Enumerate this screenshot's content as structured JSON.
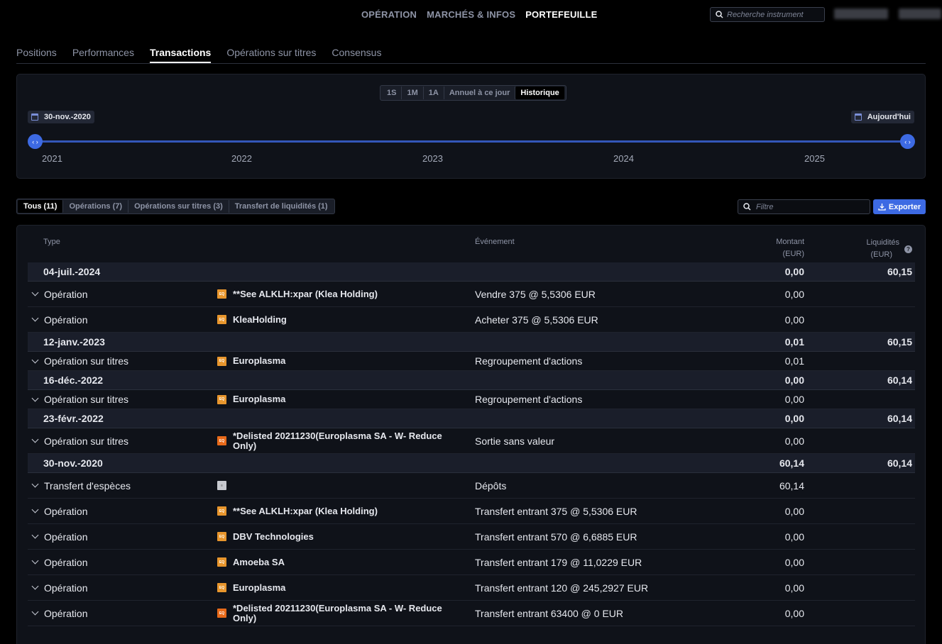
{
  "nav": {
    "links": [
      "OPÉRATION",
      "MARCHÉS & INFOS",
      "PORTEFEUILLE"
    ],
    "active": 2,
    "search_placeholder": "Recherche instrument"
  },
  "tabs": {
    "items": [
      "Positions",
      "Performances",
      "Transactions",
      "Opérations sur titres",
      "Consensus"
    ],
    "active": 2
  },
  "timeline": {
    "periods": [
      "1S",
      "1M",
      "1A",
      "Annuel à ce jour",
      "Historique"
    ],
    "active_period": 4,
    "start_date": "30-nov.-2020",
    "end_date": "Aujourd'hui",
    "years": [
      "2021",
      "2022",
      "2023",
      "2024",
      "2025"
    ],
    "handle_glyph": "‹ ›"
  },
  "filters": {
    "items": [
      "Tous (11)",
      "Opérations (7)",
      "Opérations sur titres (3)",
      "Transfert de liquidités (1)"
    ],
    "active": 0,
    "filter_placeholder": "Filtre",
    "export_label": "Exporter"
  },
  "table": {
    "headers": {
      "type": "Type",
      "event": "Événement",
      "amount": "Montant",
      "amount_unit": "(EUR)",
      "cash": "Liquidités",
      "cash_unit": "(EUR)"
    },
    "rows": [
      {
        "kind": "date",
        "label": "04-juil.-2024",
        "amount": "0,00",
        "cash": "60,15"
      },
      {
        "kind": "tx",
        "type": "Opération",
        "badge": "EQ",
        "instrument": "**See ALKLH:xpar (Klea Holding)",
        "event": "Vendre 375 @ 5,5306 EUR",
        "amount": "0,00"
      },
      {
        "kind": "tx",
        "type": "Opération",
        "badge": "EQ",
        "instrument": "KleaHolding",
        "event": "Acheter 375 @ 5,5306 EUR",
        "amount": "0,00"
      },
      {
        "kind": "date",
        "label": "12-janv.-2023",
        "amount": "0,01",
        "cash": "60,15"
      },
      {
        "kind": "tx",
        "short": true,
        "type": "Opération sur titres",
        "badge": "EQ",
        "instrument": "Europlasma",
        "event": "Regroupement d'actions",
        "amount": "0,01"
      },
      {
        "kind": "date",
        "label": "16-déc.-2022",
        "amount": "0,00",
        "cash": "60,14"
      },
      {
        "kind": "tx",
        "short": true,
        "type": "Opération sur titres",
        "badge": "EQ",
        "instrument": "Europlasma",
        "event": "Regroupement d'actions",
        "amount": "0,00"
      },
      {
        "kind": "date",
        "label": "23-févr.-2022",
        "amount": "0,00",
        "cash": "60,14"
      },
      {
        "kind": "tx",
        "type": "Opération sur titres",
        "badge": "W",
        "instrument": "*Delisted 20211230(Europlasma SA - W- Reduce Only)",
        "event": "Sortie sans valeur",
        "amount": "0,00"
      },
      {
        "kind": "date",
        "label": "30-nov.-2020",
        "amount": "60,14",
        "cash": "60,14"
      },
      {
        "kind": "tx",
        "type": "Transfert d'espèces",
        "badge": "CASH",
        "instrument": "",
        "event": "Dépôts",
        "amount": "60,14"
      },
      {
        "kind": "tx",
        "type": "Opération",
        "badge": "EQ",
        "instrument": "**See ALKLH:xpar (Klea Holding)",
        "event": "Transfert entrant 375 @ 5,5306 EUR",
        "amount": "0,00"
      },
      {
        "kind": "tx",
        "type": "Opération",
        "badge": "EQ",
        "instrument": "DBV Technologies",
        "event": "Transfert entrant 570 @ 6,6885 EUR",
        "amount": "0,00"
      },
      {
        "kind": "tx",
        "type": "Opération",
        "badge": "EQ",
        "instrument": "Amoeba SA",
        "event": "Transfert entrant 179 @ 11,0229 EUR",
        "amount": "0,00"
      },
      {
        "kind": "tx",
        "type": "Opération",
        "badge": "EQ",
        "instrument": "Europlasma",
        "event": "Transfert entrant 120 @ 245,2927 EUR",
        "amount": "0,00"
      },
      {
        "kind": "tx",
        "type": "Opération",
        "badge": "W",
        "instrument": "*Delisted 20211230(Europlasma SA - W- Reduce Only)",
        "event": "Transfert entrant 63400 @ 0 EUR",
        "amount": "0,00"
      }
    ]
  },
  "colors": {
    "accent": "#3d6ae3",
    "badge_eq": "#e8962d",
    "badge_w": "#e86a1a"
  }
}
